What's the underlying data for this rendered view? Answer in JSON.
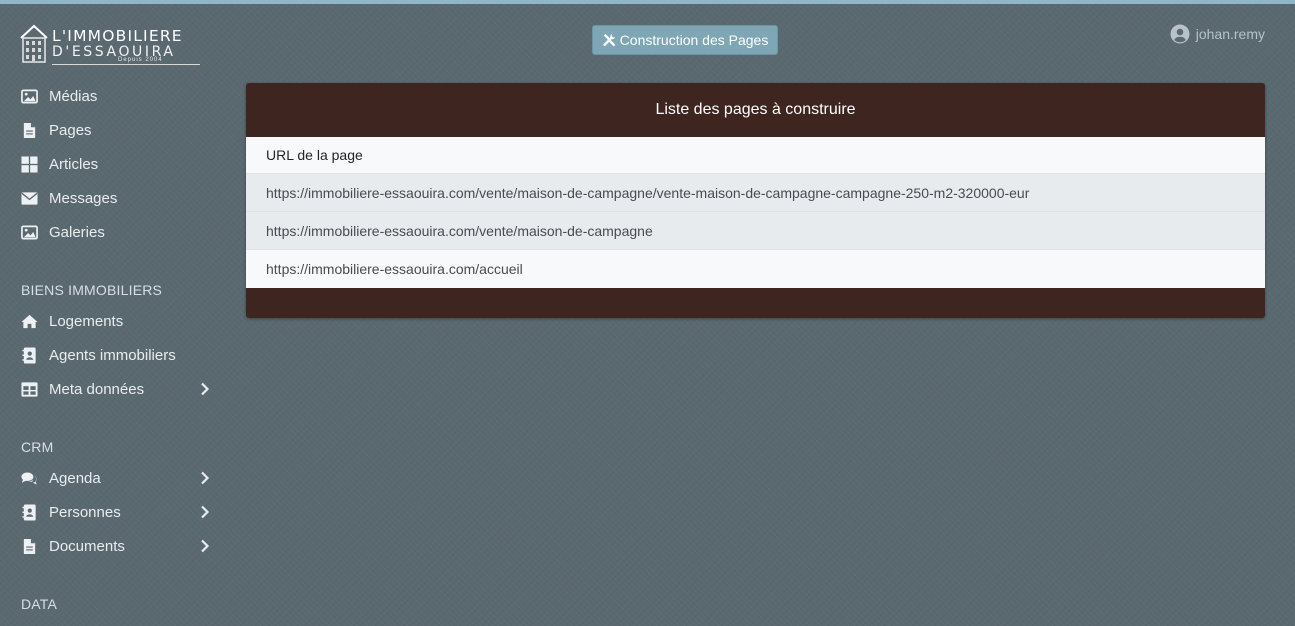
{
  "logo": {
    "line1": "L'IMMOBILIERE",
    "line2": "D'ESSAOUIRA",
    "line3": "Depuis 2004"
  },
  "header": {
    "build_button_label": "Construction des Pages",
    "username": "johan.remy"
  },
  "sidebar": {
    "items": [
      {
        "label": "Médias",
        "icon": "image-icon"
      },
      {
        "label": "Pages",
        "icon": "file-icon"
      },
      {
        "label": "Articles",
        "icon": "grid-icon"
      },
      {
        "label": "Messages",
        "icon": "envelope-icon"
      },
      {
        "label": "Galeries",
        "icon": "images-icon"
      }
    ],
    "sections": [
      {
        "title": "BIENS IMMOBILIERS",
        "items": [
          {
            "label": "Logements",
            "icon": "home-icon"
          },
          {
            "label": "Agents immobiliers",
            "icon": "address-book-icon"
          },
          {
            "label": "Meta données",
            "icon": "table-icon",
            "has_submenu": true
          }
        ]
      },
      {
        "title": "CRM",
        "items": [
          {
            "label": "Agenda",
            "icon": "comments-icon",
            "has_submenu": true
          },
          {
            "label": "Personnes",
            "icon": "contact-icon",
            "has_submenu": true
          },
          {
            "label": "Documents",
            "icon": "document-icon",
            "has_submenu": true
          }
        ]
      },
      {
        "title": "DATA",
        "items": []
      }
    ]
  },
  "main": {
    "panel_title": "Liste des pages à construire",
    "table": {
      "header": "URL de la page",
      "rows": [
        "https://immobiliere-essaouira.com/vente/maison-de-campagne/vente-maison-de-campagne-campagne-250-m2-320000-eur",
        "https://immobiliere-essaouira.com/vente/maison-de-campagne",
        "https://immobiliere-essaouira.com/accueil"
      ]
    }
  },
  "colors": {
    "background": "#5a6870",
    "panel": "#3e2520",
    "button": "#7fa6b5",
    "top_strip": "#8fb6c9"
  }
}
